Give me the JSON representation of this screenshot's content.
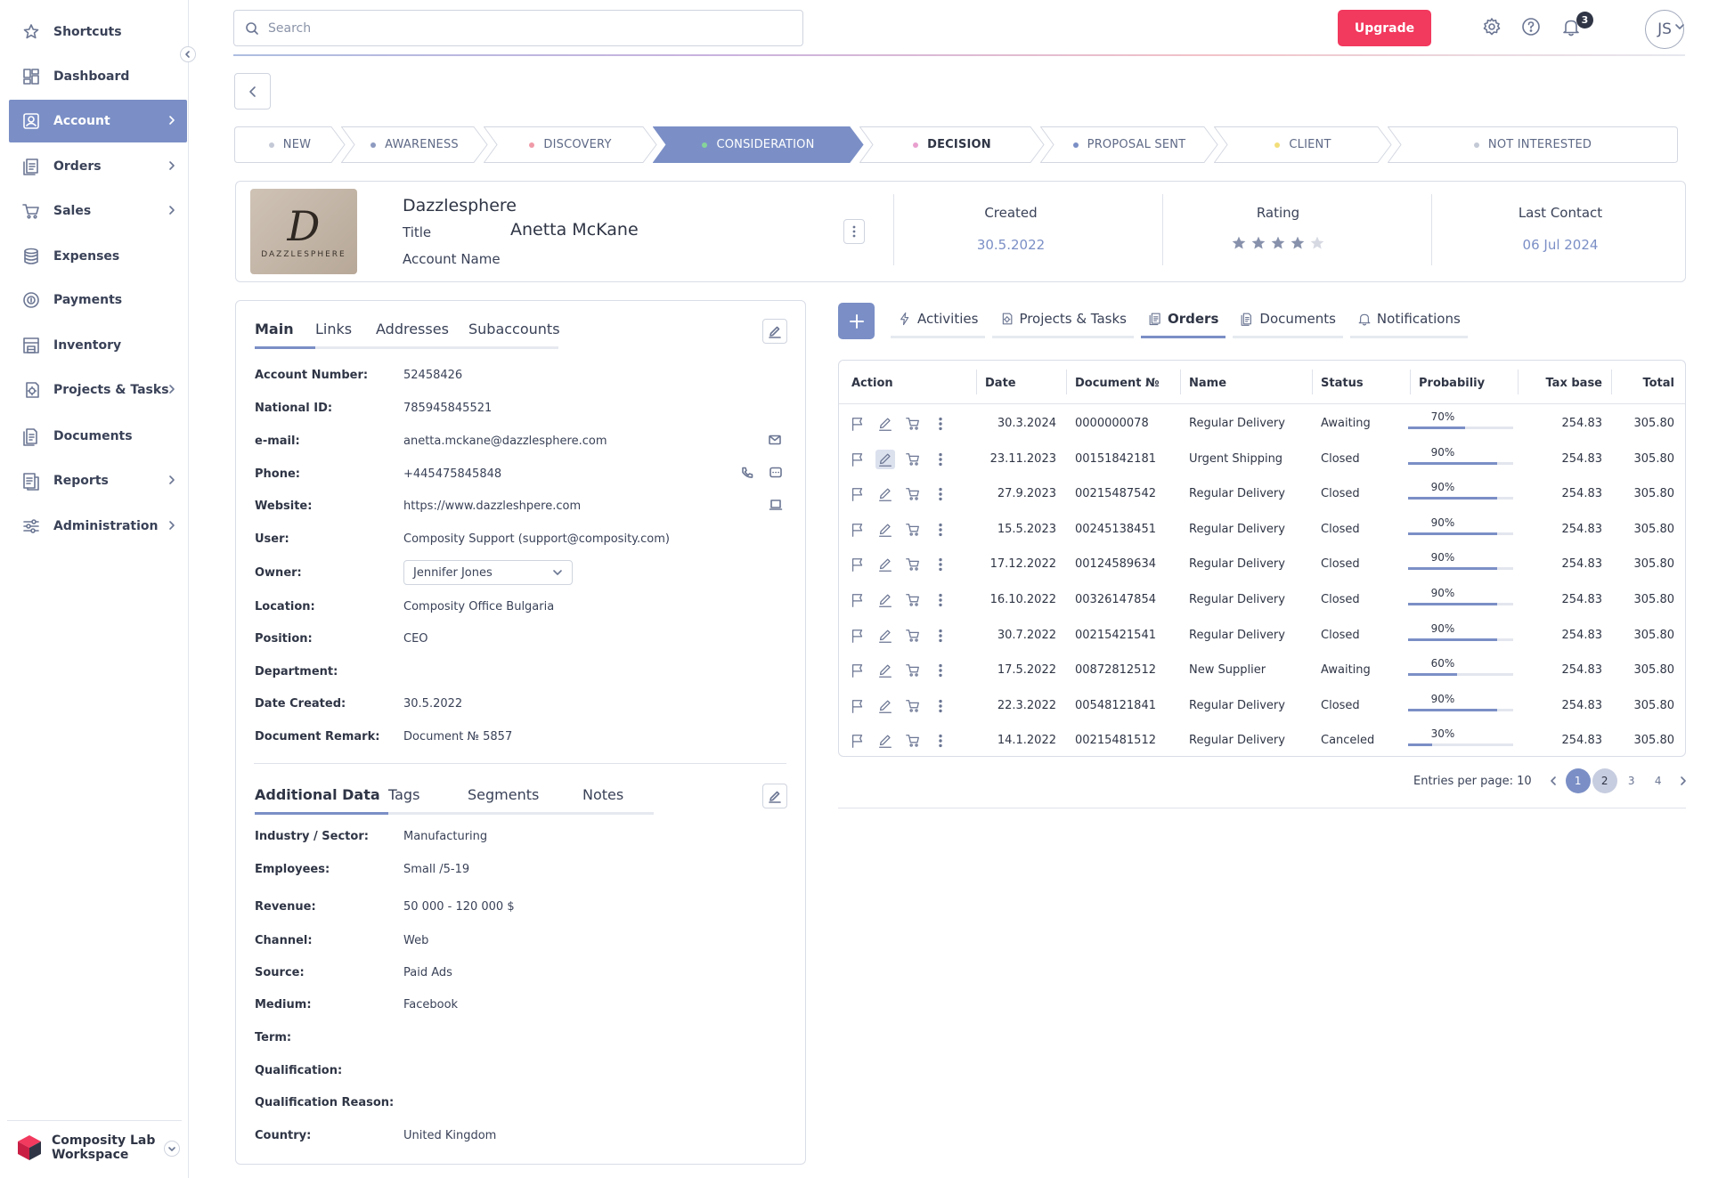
{
  "sidebar": {
    "items": [
      {
        "label": "Shortcuts",
        "icon": "star-icon"
      },
      {
        "label": "Dashboard",
        "icon": "dashboard-icon"
      },
      {
        "label": "Account",
        "icon": "account-icon"
      },
      {
        "label": "Orders",
        "icon": "orders-icon"
      },
      {
        "label": "Sales",
        "icon": "cart-icon"
      },
      {
        "label": "Expenses",
        "icon": "database-icon"
      },
      {
        "label": "Payments",
        "icon": "coins-icon"
      },
      {
        "label": "Inventory",
        "icon": "warehouse-icon"
      },
      {
        "label": "Projects & Tasks",
        "icon": "gear-doc-icon"
      },
      {
        "label": "Documents",
        "icon": "document-icon"
      },
      {
        "label": "Reports",
        "icon": "report-icon"
      },
      {
        "label": "Administration",
        "icon": "sliders-icon"
      }
    ],
    "active": "Account",
    "workspace": {
      "line1": "Composity Lab",
      "line2": "Workspace"
    }
  },
  "header": {
    "search_placeholder": "Search",
    "upgrade_label": "Upgrade",
    "notification_count": "3",
    "avatar_initials": "JS"
  },
  "pipeline": {
    "stages": [
      {
        "label": "NEW",
        "dot": "#c4c9d6"
      },
      {
        "label": "AWARENESS",
        "dot": "#8d9ac0"
      },
      {
        "label": "DISCOVERY",
        "dot": "#f09aa8"
      },
      {
        "label": "CONSIDERATION",
        "dot": "#86d49a"
      },
      {
        "label": "DECISION",
        "dot": "#e9a0cf"
      },
      {
        "label": "PROPOSAL SENT",
        "dot": "#7b8fc6"
      },
      {
        "label": "CLIENT",
        "dot": "#f2de7a"
      },
      {
        "label": "NOT INTERESTED",
        "dot": "#c4c9d6"
      }
    ],
    "active": "CONSIDERATION"
  },
  "account_card": {
    "logo_word": "DAZZLESPHERE",
    "logo_letter": "D",
    "name": "Dazzlesphere",
    "title_label": "Title",
    "person": "Anetta McKane",
    "account_name_label": "Account Name",
    "created_label": "Created",
    "created_value": "30.5.2022",
    "rating_label": "Rating",
    "rating_value": 4,
    "rating_max": 5,
    "last_contact_label": "Last Contact",
    "last_contact_value": "06 Jul 2024"
  },
  "main_tabs": [
    "Main",
    "Links",
    "Addresses",
    "Subaccounts"
  ],
  "main_fields": [
    {
      "label": "Account Number:",
      "value": "52458426"
    },
    {
      "label": "National ID:",
      "value": "785945845521"
    },
    {
      "label": "e-mail:",
      "value": "anetta.mckane@dazzlesphere.com"
    },
    {
      "label": "Phone:",
      "value": "+445475845848"
    },
    {
      "label": "Website:",
      "value": "https://www.dazzleshpere.com"
    },
    {
      "label": "User:",
      "value": "Composity Support (support@composity.com)"
    },
    {
      "label": "Owner:",
      "value": "Jennifer Jones"
    },
    {
      "label": "Location:",
      "value": "Composity Office Bulgaria"
    },
    {
      "label": "Position:",
      "value": "CEO"
    },
    {
      "label": "Department:",
      "value": ""
    },
    {
      "label": "Date Created:",
      "value": "30.5.2022"
    },
    {
      "label": "Document Remark:",
      "value": "Document № 5857"
    }
  ],
  "additional_tabs": [
    "Additional Data",
    "Tags",
    "Segments",
    "Notes"
  ],
  "additional_fields": [
    {
      "label": "Industry / Sector:",
      "value": "Manufacturing"
    },
    {
      "label": "Employees:",
      "value": "Small /5-19"
    },
    {
      "label": "Revenue:",
      "value": "50 000 - 120 000 $"
    },
    {
      "label": "Channel:",
      "value": "Web"
    },
    {
      "label": "Source:",
      "value": "Paid Ads"
    },
    {
      "label": "Medium:",
      "value": "Facebook"
    },
    {
      "label": "Term:",
      "value": ""
    },
    {
      "label": "Qualification:",
      "value": ""
    },
    {
      "label": "Qualification Reason:",
      "value": ""
    },
    {
      "label": "Country:",
      "value": "United Kingdom"
    }
  ],
  "right_tabs": [
    {
      "label": "Activities",
      "icon": "bolt-icon"
    },
    {
      "label": "Projects & Tasks",
      "icon": "gear-doc-icon"
    },
    {
      "label": "Orders",
      "icon": "orders-icon"
    },
    {
      "label": "Documents",
      "icon": "document-icon"
    },
    {
      "label": "Notifications",
      "icon": "bell-icon"
    }
  ],
  "right_active": "Orders",
  "orders": {
    "columns": [
      "Action",
      "Date",
      "Document №",
      "Name",
      "Status",
      "Probabiliy",
      "Tax base",
      "Total"
    ],
    "rows": [
      {
        "date": "30.3.2024",
        "doc": "0000000078",
        "name": "Regular Delivery",
        "status": "Awaiting",
        "prob": 70,
        "tax": "254.83",
        "total": "305.80"
      },
      {
        "date": "23.11.2023",
        "doc": "00151842181",
        "name": "Urgent Shipping",
        "status": "Closed",
        "prob": 90,
        "tax": "254.83",
        "total": "305.80"
      },
      {
        "date": "27.9.2023",
        "doc": "00215487542",
        "name": "Regular Delivery",
        "status": "Closed",
        "prob": 90,
        "tax": "254.83",
        "total": "305.80"
      },
      {
        "date": "15.5.2023",
        "doc": "00245138451",
        "name": "Regular Delivery",
        "status": "Closed",
        "prob": 90,
        "tax": "254.83",
        "total": "305.80"
      },
      {
        "date": "17.12.2022",
        "doc": "00124589634",
        "name": "Regular Delivery",
        "status": "Closed",
        "prob": 90,
        "tax": "254.83",
        "total": "305.80"
      },
      {
        "date": "16.10.2022",
        "doc": "00326147854",
        "name": "Regular Delivery",
        "status": "Closed",
        "prob": 90,
        "tax": "254.83",
        "total": "305.80"
      },
      {
        "date": "30.7.2022",
        "doc": "00215421541",
        "name": "Regular Delivery",
        "status": "Closed",
        "prob": 90,
        "tax": "254.83",
        "total": "305.80"
      },
      {
        "date": "17.5.2022",
        "doc": "00872812512",
        "name": "New Supplier",
        "status": "Awaiting",
        "prob": 60,
        "tax": "254.83",
        "total": "305.80"
      },
      {
        "date": "22.3.2022",
        "doc": "00548121841",
        "name": "Regular Delivery",
        "status": "Closed",
        "prob": 90,
        "tax": "254.83",
        "total": "305.80"
      },
      {
        "date": "14.1.2022",
        "doc": "00215481512",
        "name": "Regular Delivery",
        "status": "Canceled",
        "prob": 30,
        "tax": "254.83",
        "total": "305.80"
      }
    ]
  },
  "pager": {
    "entries_label": "Entries per page: 10",
    "pages": [
      "1",
      "2",
      "3",
      "4"
    ],
    "current": "1"
  },
  "colors": {
    "accent": "#7b8fc6",
    "brand": "#f2395e"
  }
}
